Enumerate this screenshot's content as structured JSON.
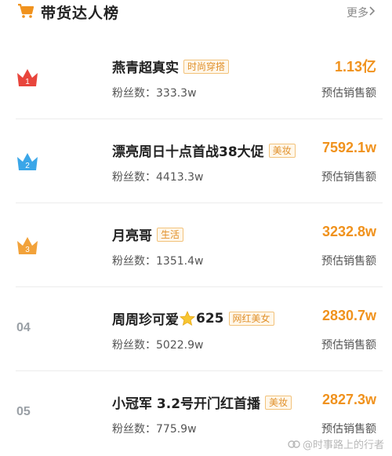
{
  "header": {
    "title": "带货达人榜",
    "more_label": "更多"
  },
  "items": [
    {
      "rank": "1",
      "name": "燕青超真实",
      "star": false,
      "name_tail": "",
      "tag": "时尚穿搭",
      "fans_label": "粉丝数：",
      "fans": "333.3w",
      "amount": "1.13亿",
      "amount_label": "预估销售额",
      "crown_color": "#e8453c"
    },
    {
      "rank": "2",
      "name": "漂亮周日十点首战38大促",
      "star": false,
      "name_tail": "",
      "tag": "美妆",
      "fans_label": "粉丝数：",
      "fans": "4413.3w",
      "amount": "7592.1w",
      "amount_label": "预估销售额",
      "crown_color": "#3aa6e8"
    },
    {
      "rank": "3",
      "name": "月亮哥",
      "star": false,
      "name_tail": "",
      "tag": "生活",
      "fans_label": "粉丝数：",
      "fans": "1351.4w",
      "amount": "3232.8w",
      "amount_label": "预估销售额",
      "crown_color": "#f2a23a"
    },
    {
      "rank": "04",
      "name": "周周珍可爱",
      "star": true,
      "name_tail": "625",
      "tag": "网红美女",
      "fans_label": "粉丝数：",
      "fans": "5022.9w",
      "amount": "2830.7w",
      "amount_label": "预估销售额"
    },
    {
      "rank": "05",
      "name": "小冠军 3.2号开门红首播",
      "star": false,
      "name_tail": "",
      "tag": "美妆",
      "fans_label": "粉丝数：",
      "fans": "775.9w",
      "amount": "2827.3w",
      "amount_label": "预估销售额"
    }
  ],
  "watermark": {
    "text": "@时事路上的行者"
  }
}
